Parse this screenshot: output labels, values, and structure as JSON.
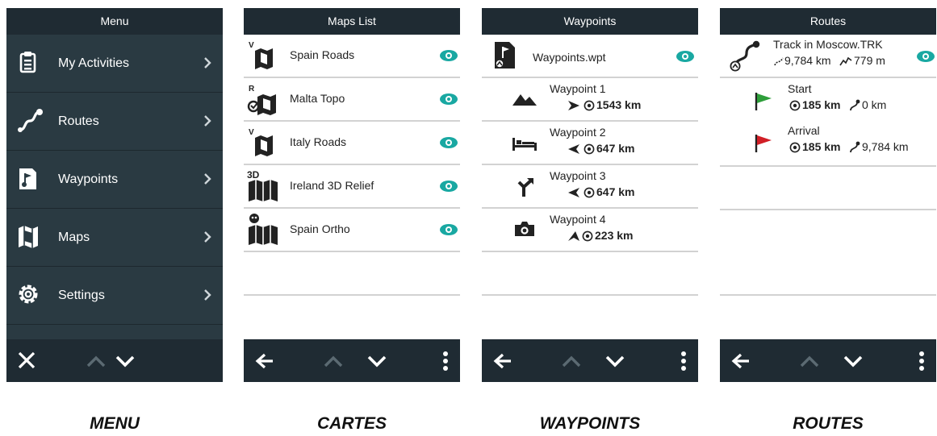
{
  "screens": {
    "menu": {
      "title": "Menu",
      "items": [
        {
          "label": "My Activities",
          "icon": "clipboard-icon"
        },
        {
          "label": "Routes",
          "icon": "route-icon"
        },
        {
          "label": "Waypoints",
          "icon": "waypoint-flag-icon"
        },
        {
          "label": "Maps",
          "icon": "map-icon"
        },
        {
          "label": "Settings",
          "icon": "gear-icon"
        }
      ],
      "caption": "MENU"
    },
    "maps": {
      "title": "Maps List",
      "items": [
        {
          "label": "Spain Roads",
          "badge": "V",
          "visible": true
        },
        {
          "label": "Malta Topo",
          "badge": "R",
          "visible": true
        },
        {
          "label": "Italy Roads",
          "badge": "V",
          "visible": true
        },
        {
          "label": "Ireland 3D Relief",
          "badge": "3D",
          "visible": true
        },
        {
          "label": "Spain Ortho",
          "badge": "",
          "visible": true
        }
      ],
      "caption": "CARTES"
    },
    "waypoints": {
      "title": "Waypoints",
      "file": "Waypoints.wpt",
      "items": [
        {
          "label": "Waypoint 1",
          "distance": "1543 km",
          "icon": "mountain-icon"
        },
        {
          "label": "Waypoint 2",
          "distance": "647 km",
          "icon": "bed-icon"
        },
        {
          "label": "Waypoint 3",
          "distance": "647 km",
          "icon": "junction-icon"
        },
        {
          "label": "Waypoint 4",
          "distance": "223 km",
          "icon": "camera-icon"
        }
      ],
      "caption": "WAYPOINTS"
    },
    "routes": {
      "title": "Routes",
      "track": {
        "name": "Track in Moscow.TRK",
        "distance": "9,784 km",
        "elevation": "779 m"
      },
      "points": [
        {
          "label": "Start",
          "distance": "185 km",
          "along": "0 km",
          "flag_color": "#2e9e3a"
        },
        {
          "label": "Arrival",
          "distance": "185 km",
          "along": "9,784 km",
          "flag_color": "#d11f26"
        }
      ],
      "caption": "ROUTES"
    }
  },
  "colors": {
    "header": "#1f2b33",
    "menu_bg": "#2a3a42",
    "accent": "#19a8a2"
  }
}
